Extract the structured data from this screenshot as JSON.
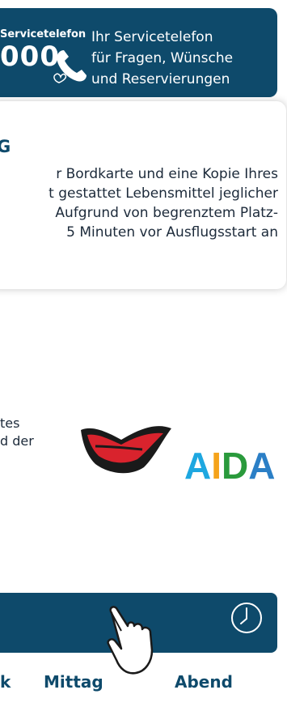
{
  "service": {
    "label": "Servicetelefon",
    "number": "000",
    "info_lines": [
      "Ihr Servicetelefon",
      "für Fragen, Wünsche",
      "und Reservierungen"
    ]
  },
  "notice": {
    "title": "G",
    "lines": [
      "r Bordkarte und eine Kopie Ihres",
      "t gestattet Lebensmittel jeglicher",
      "Aufgrund von begrenztem Platz-",
      "5 Minuten vor Ausflugsstart an"
    ]
  },
  "excerpt": [
    "tes",
    "d der"
  ],
  "brand": {
    "name": "AIDA",
    "colors": [
      "#1ea7e0",
      "#f5a31a",
      "#2a9a3c",
      "#2b7fc6"
    ]
  },
  "bottom_nav": {
    "icon": "clock-icon",
    "tabs": [
      "k",
      "Mittag",
      "Abend"
    ]
  },
  "colors": {
    "primary": "#0e4a6b"
  }
}
